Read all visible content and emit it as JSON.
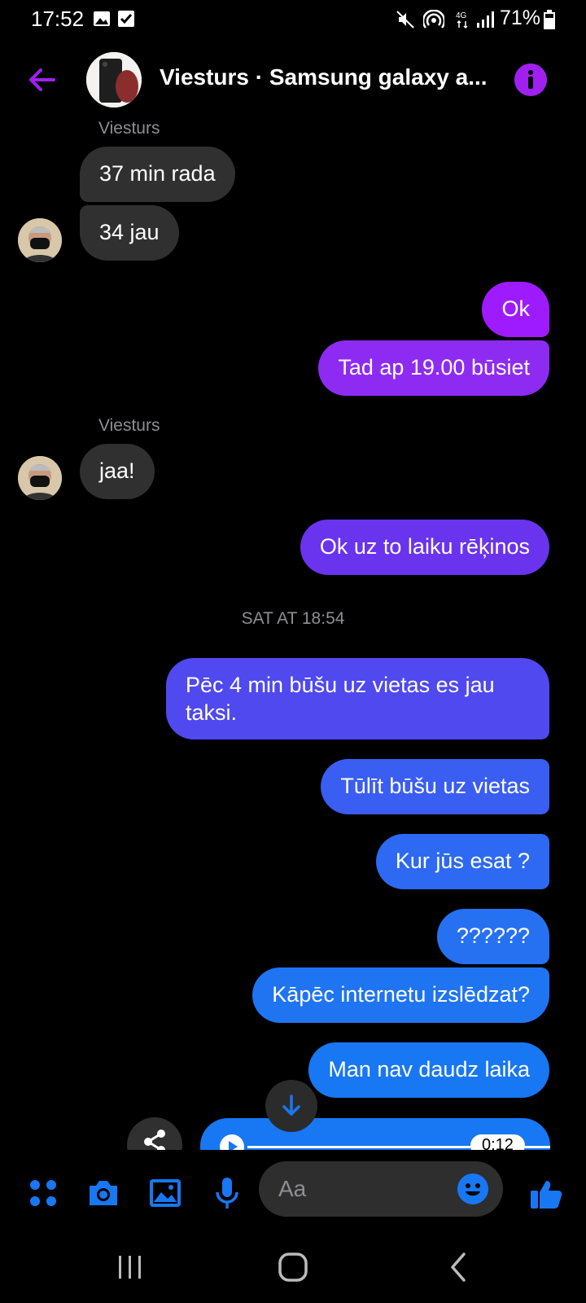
{
  "status_bar": {
    "time": "17:52",
    "battery": "71%",
    "icons": [
      "image-icon",
      "check-box-icon",
      "mute-icon",
      "hotspot-icon",
      "4g-icon",
      "signal-icon",
      "battery-icon"
    ]
  },
  "header": {
    "title": "Viesturs · Samsung galaxy a...",
    "back_icon": "arrow-left-icon",
    "info_icon": "info-icon"
  },
  "messages": {
    "m1_sender": "Viesturs",
    "m1": "37 min rada",
    "m2": "34 jau",
    "m3": "Ok",
    "m4": "Tad ap 19.00 būsiet",
    "m5_sender": "Viesturs",
    "m5": "jaa!",
    "m6": "Ok uz to laiku rēķinos",
    "date_separator": "SAT AT 18:54",
    "m7_line1": "Pēc 4 min būšu uz vietas es jau",
    "m7_line2": "taksi.",
    "m8": "Tūlīt būšu uz vietas",
    "m9": "Kur jūs esat ?",
    "m10": "??????",
    "m11": "Kāpēc internetu izslēdzat?",
    "m12": "Man nav daudz laika",
    "voice_duration": "0:12"
  },
  "composer": {
    "placeholder": "Aa",
    "icons": [
      "apps-icon",
      "camera-icon",
      "gallery-icon",
      "microphone-icon",
      "emoji-icon",
      "thumbs-up-icon"
    ]
  },
  "colors": {
    "accent_purple": "#9f1bff",
    "bubble_purple": "#8a2bf0",
    "bubble_indigo": "#5b3ef0",
    "bubble_blue": "#1877f2",
    "incoming": "#303030"
  }
}
